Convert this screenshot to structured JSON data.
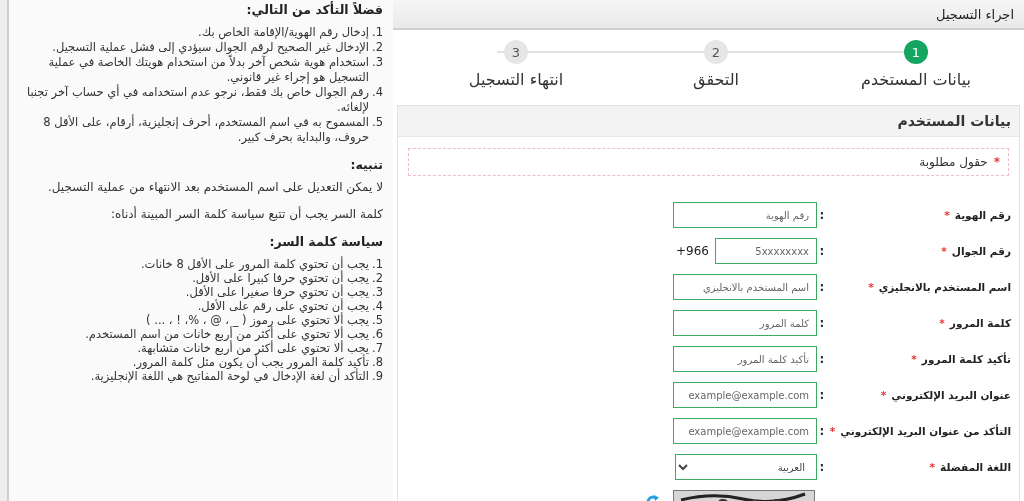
{
  "info": {
    "title": "فضلاً التأكد من التالي:",
    "items": [
      {
        "number": "1.",
        "text": "إدخال رقم الهوية/الإقامة الخاص بك."
      },
      {
        "number": "2.",
        "text": "الإدخال غير الصحيح لرقم الجوال سيؤدي إلى فشل عملية التسجيل."
      },
      {
        "number": "3.",
        "text": "استخدام هوية شخص آخر بدلاً من استخدام هويتك الخاصة في عملية التسجيل هو إجراء غير قانوني."
      },
      {
        "number": "4.",
        "text": "رقم الجوال خاص بك فقط، نرجو عدم استخدامه في أي حساب آخر تجنبا لإلغائه."
      },
      {
        "number": "5.",
        "text": "المسموح به في اسم المستخدم، أحرف إنجليزية، أرقام، على الأقل 8 حروف، والبداية بحرف كبير."
      }
    ],
    "notice_title": "تنبيه:",
    "notice": "لا يمكن التعديل على اسم المستخدم بعد الانتهاء من عملية التسجيل.",
    "password_note": "كلمة السر يجب أن تتبع سياسة كلمة السر المبينة أدناه:",
    "policy_title": "سياسة كلمة السر:",
    "policy": [
      {
        "number": "1.",
        "text": "يجب أن تحتوي كلمة المرور على الأقل 8 خانات."
      },
      {
        "number": "2.",
        "text": "يجب أن تحتوي حرفا كبيرا على الأقل."
      },
      {
        "number": "3.",
        "text": "يجب أن تحتوي حرفا صغيرا على الأقل."
      },
      {
        "number": "4.",
        "text": "يجب أن تحتوي على رقم على الأقل."
      },
      {
        "number": "5.",
        "text": "يجب ألا تحتوي على رموز ( _ ، @ ، %، ! ، ... )"
      },
      {
        "number": "6.",
        "text": "يجب ألا تحتوي على أكثر من أربع خانات من اسم المستخدم."
      },
      {
        "number": "7.",
        "text": "يجب ألا تحتوي على أكثر من أربع خانات متشابهة."
      },
      {
        "number": "8.",
        "text": "تأكيد كلمة المرور يجب أن يكون مثل كلمة المرور."
      },
      {
        "number": "9.",
        "text": "التأكد أن لغة الإدخال في لوحة المفاتيح هي اللغة الإنجليزية."
      }
    ]
  },
  "page_title": "اجراء التسجيل",
  "steps": [
    {
      "number": "1",
      "label": "بيانات المستخدم",
      "selected": true
    },
    {
      "number": "2",
      "label": "التحقق",
      "selected": false
    },
    {
      "number": "3",
      "label": "انتهاء التسجيل",
      "selected": false
    }
  ],
  "form": {
    "title": "بيانات المستخدم",
    "required_note": {
      "mark": "*",
      "text": "حقول مطلوبة"
    },
    "fields": [
      {
        "kind": "text",
        "label": "رقم الهوية",
        "required_mark": "*",
        "colon": ":",
        "placeholder": "رقم الهوية"
      },
      {
        "kind": "phone",
        "label": "رقم الجوال",
        "required_mark": "*",
        "colon": ":",
        "placeholder": "5xxxxxxxx",
        "prefix": "+966"
      },
      {
        "kind": "text",
        "label": "اسم المستخدم بالانجليزي",
        "required_mark": "*",
        "colon": ":",
        "placeholder": "اسم المستخدم بالانجليزي"
      },
      {
        "kind": "text",
        "label": "كلمة المرور",
        "required_mark": "*",
        "colon": ":",
        "placeholder": "كلمة المرور"
      },
      {
        "kind": "text",
        "label": "تأكيد كلمة المرور",
        "required_mark": "*",
        "colon": ":",
        "placeholder": "تأكيد كلمة المرور"
      },
      {
        "kind": "text",
        "label": "عنوان البريد الإلكتروني",
        "required_mark": "*",
        "colon": ":",
        "placeholder": "example@example.com"
      },
      {
        "kind": "text",
        "label": "التأكد من عنوان البريد الإلكتروني",
        "required_mark": "*",
        "colon": ":",
        "placeholder": "example@example.com"
      },
      {
        "kind": "select",
        "label": "اللغة المفضلة",
        "required_mark": "*",
        "colon": ":",
        "value": "العربية"
      },
      {
        "kind": "captcha"
      }
    ]
  }
}
